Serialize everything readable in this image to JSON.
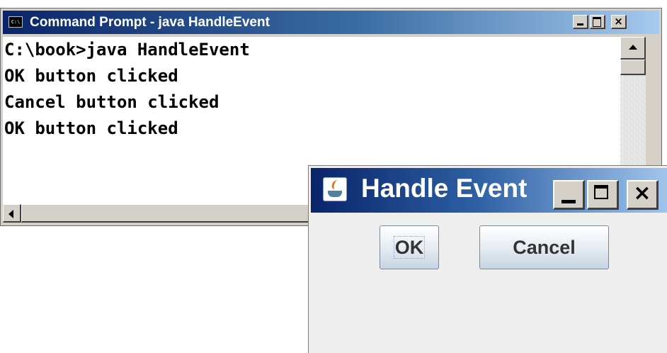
{
  "cmd": {
    "title": "Command Prompt - java HandleEvent",
    "icon": "C:\\",
    "controls": {
      "minimize": "minimize-icon",
      "maximize": "maximize-icon",
      "close": "×"
    },
    "lines": [
      "C:\\book>java HandleEvent",
      "OK button clicked",
      "Cancel button clicked",
      "OK button clicked"
    ]
  },
  "dialog": {
    "title": "Handle Event",
    "icon": "java-cup-icon",
    "controls": {
      "minimize": "minimize-icon",
      "maximize": "maximize-icon",
      "close": "×"
    },
    "ok_label": "OK",
    "cancel_label": "Cancel"
  },
  "colors": {
    "titlebar_active_start": "#0a246a",
    "titlebar_active_end": "#a6caf0",
    "window_face": "#d4d0c8",
    "dialog_background": "#eeeeee"
  }
}
